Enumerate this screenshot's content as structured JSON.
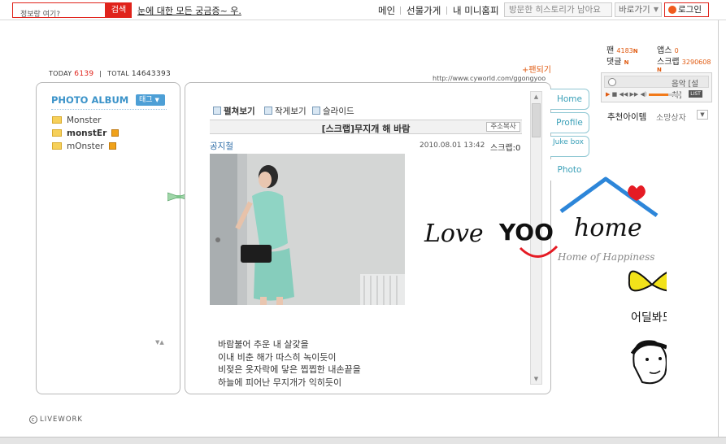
{
  "topbar": {
    "search_placeholder": "정보랑 여기?",
    "search_button": "검색",
    "question": "눈에 대한 모든 궁금증~ 우.",
    "nav": [
      "메인",
      "선물가게",
      "내 미니홈피"
    ],
    "history": "방문한 히스토리가 남아요",
    "shortcut": "바로가기",
    "login": "로그인"
  },
  "counter": {
    "today_label": "TODAY",
    "today_value": "6139",
    "total_label": "TOTAL",
    "total_value": "14643393"
  },
  "fan_add": "팬되기",
  "url": "http://www.cyworld.com/ggongyoo",
  "album": {
    "title": "PHOTO ALBUM",
    "tag_button": "태그",
    "folders": [
      {
        "name": "Monster",
        "bold": false,
        "new": false
      },
      {
        "name": "monstEr",
        "bold": true,
        "new": true
      },
      {
        "name": "mOnster",
        "bold": false,
        "new": true
      }
    ]
  },
  "view_options": [
    "펼쳐보기",
    "작게보기",
    "슬라이드"
  ],
  "post": {
    "title": "[스크랩]무지개 해 바람",
    "addr_copy": "주소복사",
    "author": "공지철",
    "date": "2010.08.01 13:42",
    "scrap_label": "스크랩:0",
    "poem": [
      "바람불어 추운 내 살갗을",
      "이내 비춘 해가 따스히 녹이듯이",
      "비젖은 옷자락에 닿은 찝찝한 내손끝을",
      "하늘에 피어난 무지개가 익히듯이"
    ]
  },
  "tabs": [
    "Home",
    "Profile",
    "Juke box",
    "Photo"
  ],
  "sidebar": {
    "fan_label": "팬",
    "fan_value": "4183",
    "apps_label": "앱스",
    "apps_value": "0",
    "comment_label": "댓글",
    "scrap_label": "스크랩",
    "scrap_value": "3290608",
    "new_mark": "N",
    "player_label": "음악 [설치]",
    "list_label": "LIST",
    "reco_item": "추천아이템",
    "reco_shop": "소망상자"
  },
  "artwork": {
    "love_text": "Love",
    "yoo_text": "YOO",
    "home_text": "home",
    "subtitle": "Home of Happiness",
    "caption": "어딜봐도 미남"
  },
  "footer": {
    "livework": "LIVEWORK"
  },
  "colors": {
    "accent_red": "#e0231b",
    "album_blue": "#3b93c9",
    "tab_teal": "#3aa0b8",
    "orange": "#e05a10"
  }
}
